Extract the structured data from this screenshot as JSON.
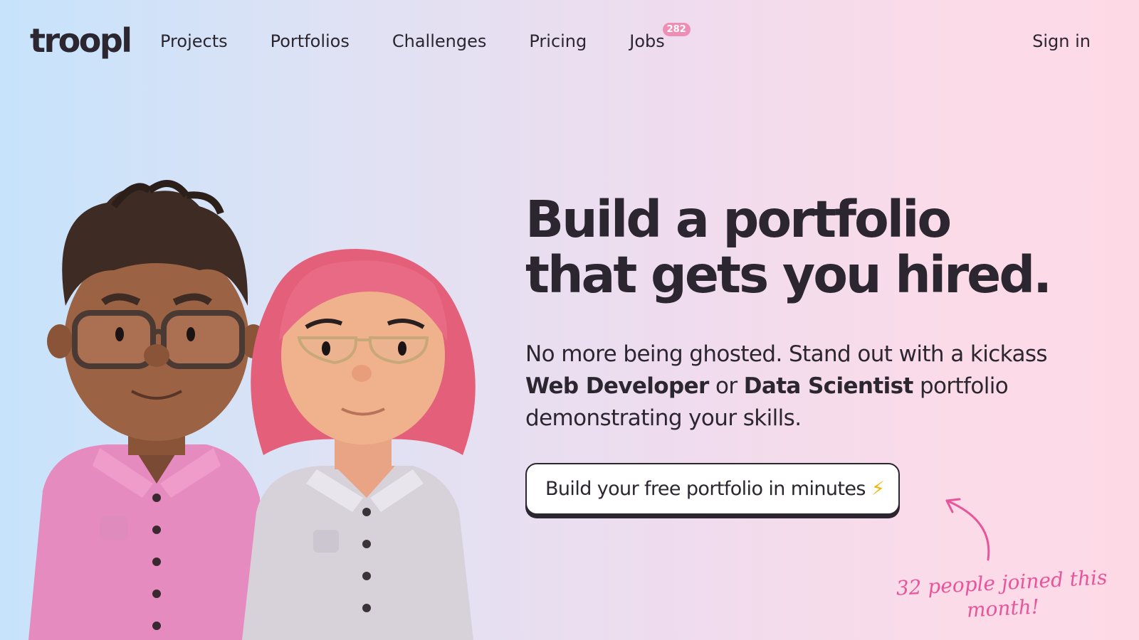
{
  "logo": "troopl",
  "nav": {
    "items": [
      {
        "label": "Projects"
      },
      {
        "label": "Portfolios"
      },
      {
        "label": "Challenges"
      },
      {
        "label": "Pricing"
      },
      {
        "label": "Jobs",
        "badge": "282"
      }
    ],
    "signin": "Sign in"
  },
  "hero": {
    "headline_line1": "Build a portfolio",
    "headline_line2": "that gets you hired.",
    "sub_part1": "No more being ghosted. Stand out with a kickass",
    "sub_bold1": "Web Developer",
    "sub_part2": "or",
    "sub_bold2": "Data Scientist",
    "sub_part3": "portfolio demonstrating your skills.",
    "cta_label": "Build your free portfolio in minutes",
    "cta_icon": "⚡",
    "joined_note": "32 people joined this month!"
  },
  "colors": {
    "accent_pink": "#e8559b",
    "badge_pink": "#ef8eb4",
    "text_dark": "#2b2630"
  }
}
